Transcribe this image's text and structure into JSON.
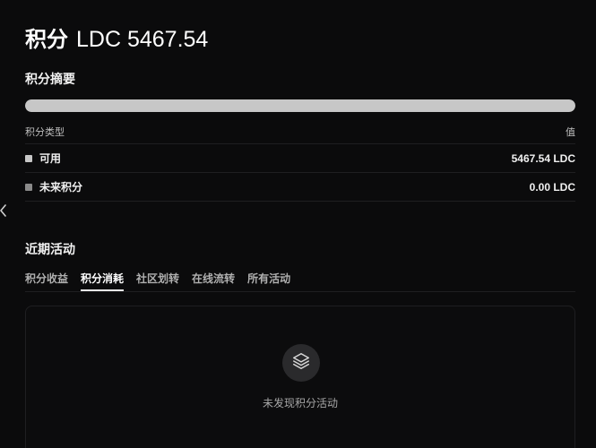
{
  "header": {
    "title": "积分",
    "amount": "LDC 5467.54"
  },
  "summary": {
    "title": "积分摘要",
    "progress_fraction": 1.0,
    "progress_color": "#c7c7c7",
    "table": {
      "header_type": "积分类型",
      "header_value": "值",
      "rows": [
        {
          "label": "可用",
          "value": "5467.54 LDC",
          "color": "#c7c7c7"
        },
        {
          "label": "未来积分",
          "value": "0.00 LDC",
          "color": "#8a8a8a"
        }
      ]
    }
  },
  "activity": {
    "title": "近期活动",
    "tabs": [
      {
        "label": "积分收益",
        "active": false
      },
      {
        "label": "积分消耗",
        "active": true
      },
      {
        "label": "社区划转",
        "active": false
      },
      {
        "label": "在线流转",
        "active": false
      },
      {
        "label": "所有活动",
        "active": false
      }
    ],
    "empty_icon": "layers-icon",
    "empty_text": "未发现积分活动"
  },
  "nav": {
    "back_icon": "chevron-left-icon"
  }
}
